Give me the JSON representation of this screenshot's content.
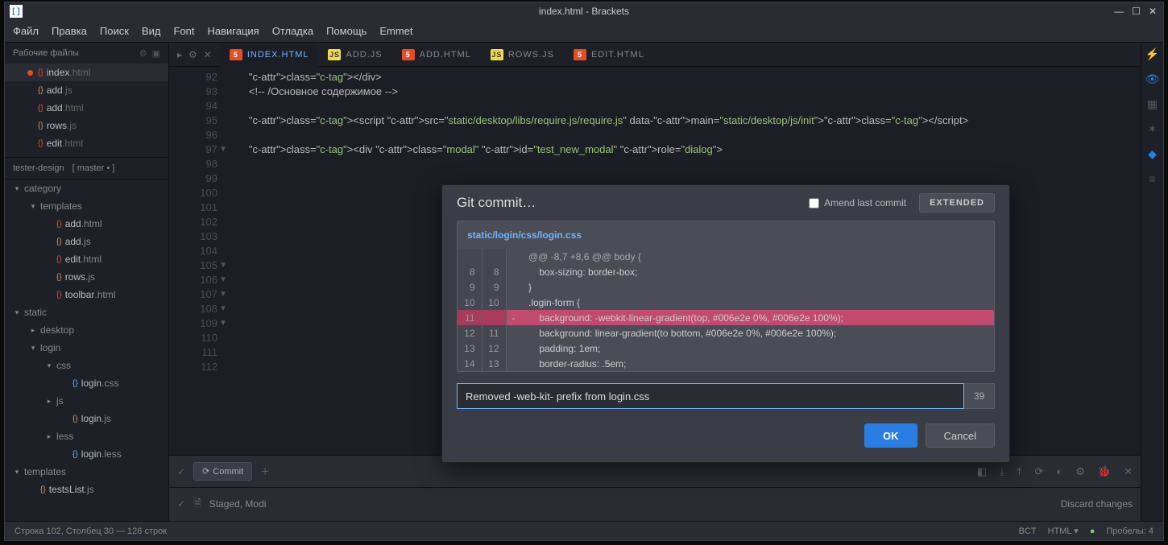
{
  "titlebar": {
    "title": "index.html - Brackets"
  },
  "menu": {
    "file": "Файл",
    "edit": "Правка",
    "find": "Поиск",
    "view": "Вид",
    "font": "Font",
    "nav": "Навигация",
    "debug": "Отладка",
    "help": "Помощь",
    "emmet": "Emmet"
  },
  "sidebar": {
    "working_header": "Рабочие файлы",
    "working": [
      {
        "name": "index",
        "ext": ".html",
        "color": "#e44d26",
        "active": true
      },
      {
        "name": "add",
        "ext": ".js",
        "color": "#d19a66",
        "active": false
      },
      {
        "name": "add",
        "ext": ".html",
        "color": "#e44d26",
        "active": false
      },
      {
        "name": "rows",
        "ext": ".js",
        "color": "#d19a66",
        "active": false
      },
      {
        "name": "edit",
        "ext": ".html",
        "color": "#e44d26",
        "active": false
      }
    ],
    "project": "tester-design",
    "branch": "[ master • ]",
    "tree": [
      {
        "d": 0,
        "label": "category",
        "exp": true
      },
      {
        "d": 1,
        "label": "templates",
        "exp": true
      },
      {
        "d": 2,
        "label": "add",
        "ext": ".html",
        "file": true,
        "color": "#e44d26"
      },
      {
        "d": 2,
        "label": "add",
        "ext": ".js",
        "file": true,
        "color": "#d19a66"
      },
      {
        "d": 2,
        "label": "edit",
        "ext": ".html",
        "file": true,
        "color": "#e44d26"
      },
      {
        "d": 2,
        "label": "rows",
        "ext": ".js",
        "file": true,
        "color": "#d19a66"
      },
      {
        "d": 2,
        "label": "toolbar",
        "ext": ".html",
        "file": true,
        "color": "#e44d26"
      },
      {
        "d": 0,
        "label": "static",
        "exp": true
      },
      {
        "d": 1,
        "label": "desktop",
        "exp": false
      },
      {
        "d": 1,
        "label": "login",
        "exp": true
      },
      {
        "d": 2,
        "label": "css",
        "exp": true
      },
      {
        "d": 3,
        "label": "login",
        "ext": ".css",
        "file": true,
        "color": "#6fb4ff"
      },
      {
        "d": 2,
        "label": "js",
        "exp": false
      },
      {
        "d": 3,
        "label": "login",
        "ext": ".js",
        "file": true,
        "color": "#d19a66"
      },
      {
        "d": 2,
        "label": "less",
        "exp": false
      },
      {
        "d": 3,
        "label": "login",
        "ext": ".less",
        "file": true,
        "color": "#6fb4ff"
      },
      {
        "d": 0,
        "label": "templates",
        "exp": true
      },
      {
        "d": 1,
        "label": "testsList",
        "ext": ".js",
        "file": true,
        "color": "#d19a66"
      }
    ]
  },
  "tabs": [
    {
      "icon": "html",
      "label": "index.html",
      "active": true
    },
    {
      "icon": "js",
      "label": "add.js"
    },
    {
      "icon": "html",
      "label": "add.html"
    },
    {
      "icon": "js",
      "label": "rows.js"
    },
    {
      "icon": "html",
      "label": "edit.html"
    }
  ],
  "code": {
    "start": 92,
    "lines": [
      "        </div>",
      "        <!-- /Основное содержимое -->",
      "",
      "        <script src=\"static/desktop/libs/require.js/require.js\" data-main=\"static/desktop/js/init\"></script>",
      "",
      "        <div class=\"modal\" id=\"test_new_modal\" role=\"dialog\">",
      "",
      "",
      "",
      "",
      "",
      "",
      "",
      "",
      "",
      "",
      "",
      "",
      "",
      "",
      ""
    ],
    "folds": [
      97,
      105,
      106,
      107,
      108,
      109
    ]
  },
  "git": {
    "commit_btn": "Commit",
    "staged": "Staged, Modi",
    "discard": "Discard changes"
  },
  "status": {
    "cursor": "Строка 102, Столбец 30 — 126 строк",
    "ins": "BCT",
    "lang": "HTML",
    "spaces": "Пробелы: 4"
  },
  "modal": {
    "title": "Git commit…",
    "amend": "Amend last commit",
    "extended": "EXTENDED",
    "file": "static/login/css/login.css",
    "diff": [
      {
        "a": "",
        "b": "",
        "m": "",
        "t": "@@ -8,7 +8,6 @@ body {",
        "hunk": true
      },
      {
        "a": "8",
        "b": "8",
        "m": "",
        "t": "    box-sizing: border-box;"
      },
      {
        "a": "9",
        "b": "9",
        "m": "",
        "t": "}"
      },
      {
        "a": "10",
        "b": "10",
        "m": "",
        "t": ".login-form {"
      },
      {
        "a": "11",
        "b": "",
        "m": "-",
        "t": "    background: -webkit-linear-gradient(top, #006e2e 0%, #006e2e 100%);",
        "del": true
      },
      {
        "a": "12",
        "b": "11",
        "m": "",
        "t": "    background: linear-gradient(to bottom, #006e2e 0%, #006e2e 100%);"
      },
      {
        "a": "13",
        "b": "12",
        "m": "",
        "t": "    padding: 1em;"
      },
      {
        "a": "14",
        "b": "13",
        "m": "",
        "t": "    border-radius: .5em;"
      }
    ],
    "message": "Removed -web-kit- prefix from login.css",
    "count": "39",
    "ok": "OK",
    "cancel": "Cancel"
  }
}
